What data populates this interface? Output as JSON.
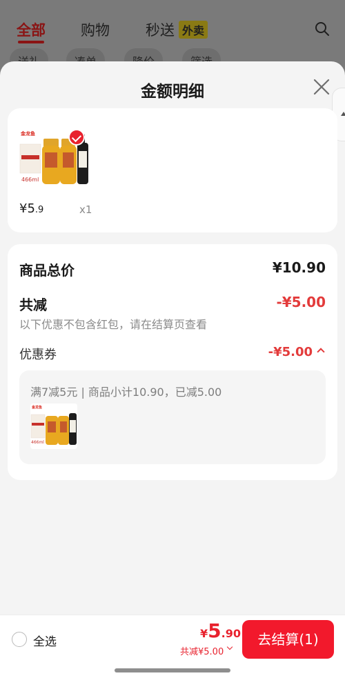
{
  "background": {
    "tabs": [
      {
        "label": "全部",
        "active": true
      },
      {
        "label": "购物",
        "active": false
      },
      {
        "label": "秒送",
        "active": false
      }
    ],
    "takeout_badge": "外卖",
    "chips": [
      "送礼",
      "凑单",
      "降价",
      "筛选"
    ]
  },
  "sheet": {
    "title": "金额明细"
  },
  "product": {
    "price_int": "¥5",
    "price_dec": ".9",
    "quantity": "x1",
    "thumb_brand": "金龙鱼",
    "thumb_volume": "466ml"
  },
  "summary": {
    "total_label": "商品总价",
    "total_value": "¥10.90",
    "discount_label": "共减",
    "discount_value": "-¥5.00",
    "note": "以下优惠不包含红包，请在结算页查看",
    "coupon_label": "优惠券",
    "coupon_value": "-¥5.00",
    "coupon_desc": "满7减5元 | 商品小计10.90，已减5.00"
  },
  "footer": {
    "select_all": "全选",
    "price_yen": "¥",
    "price_int": "5",
    "price_dec": ".90",
    "discount": "共减¥5.00",
    "checkout": "去结算(1)"
  },
  "colors": {
    "accent": "#f2192c",
    "discount_text": "#e33b3b"
  }
}
